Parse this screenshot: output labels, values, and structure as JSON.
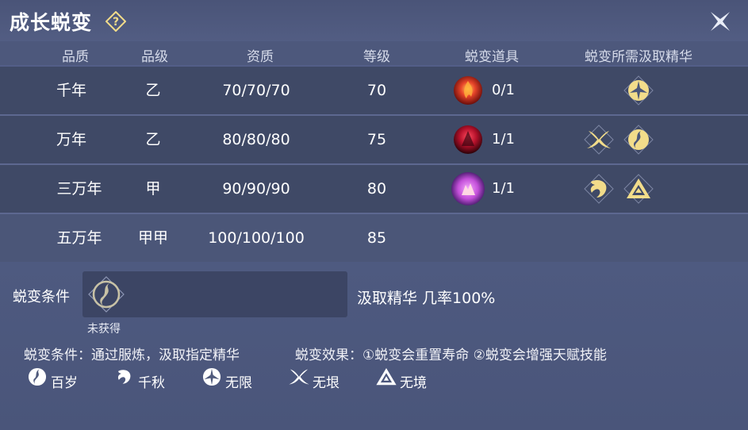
{
  "window": {
    "title": "成长蜕变"
  },
  "table": {
    "headers": [
      "品质",
      "品级",
      "资质",
      "等级",
      "蜕变道具",
      "蜕变所需汲取精华"
    ],
    "rows": [
      {
        "quality": "千年",
        "grade": "乙",
        "aptitude": "70/70/70",
        "level": "70",
        "item_count": "0/1",
        "item_color": "#e8452a",
        "essences": [
          "wuxian"
        ]
      },
      {
        "quality": "万年",
        "grade": "乙",
        "aptitude": "80/80/80",
        "level": "75",
        "item_count": "1/1",
        "item_color": "#b3102a",
        "essences": [
          "wuyin",
          "baisui"
        ]
      },
      {
        "quality": "三万年",
        "grade": "甲",
        "aptitude": "90/90/90",
        "level": "80",
        "item_count": "1/1",
        "item_color": "#c24fd8",
        "essences": [
          "qianqiu",
          "wujing"
        ]
      },
      {
        "quality": "五万年",
        "grade": "甲甲",
        "aptitude": "100/100/100",
        "level": "85"
      }
    ]
  },
  "condition": {
    "label": "蜕变条件",
    "slot_status": "未获得",
    "rate_text": "汲取精华 几率100%"
  },
  "descriptions": {
    "condition": "蜕变条件：通过服炼，汲取指定精华",
    "effect": "蜕变效果：①蜕变会重置寿命 ②蜕变会增强天赋技能"
  },
  "legend": [
    {
      "icon": "baisui-icon",
      "label": "百岁"
    },
    {
      "icon": "qianqiu-icon",
      "label": "千秋"
    },
    {
      "icon": "wuxian-icon",
      "label": "无限"
    },
    {
      "icon": "wuyin-icon",
      "label": "无垠"
    },
    {
      "icon": "wujing-icon",
      "label": "无境"
    }
  ],
  "colors": {
    "essence_gold": "#f2dc8a",
    "panel": "#4f5a7c"
  }
}
